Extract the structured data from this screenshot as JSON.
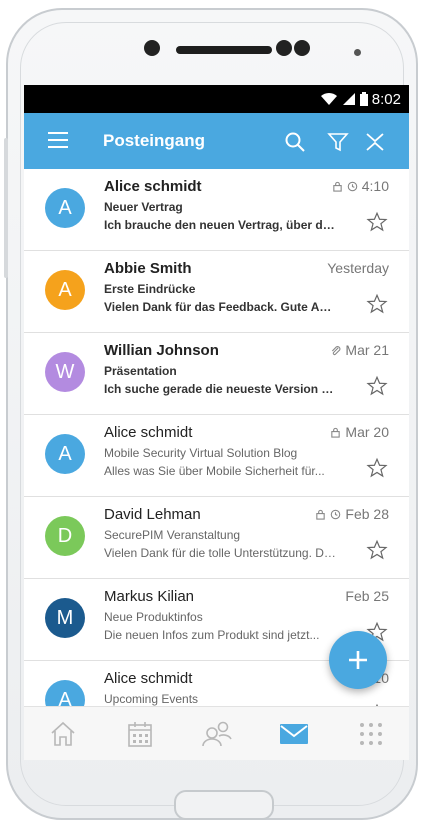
{
  "status_bar": {
    "time": "8:02"
  },
  "app_bar": {
    "title": "Posteingang",
    "icons": [
      "menu-icon",
      "search-icon",
      "filter-icon",
      "collapse-icon"
    ]
  },
  "messages": [
    {
      "sender": "Alice schmidt",
      "subject": "Neuer Vertrag",
      "preview": "Ich brauche den neuen Vertrag, über den...",
      "time": "4:10",
      "avatar_letter": "A",
      "avatar_color": "#4aa8e0",
      "unread": true,
      "meta_icons": [
        "lock-icon",
        "clock-icon"
      ]
    },
    {
      "sender": "Abbie Smith",
      "subject": "Erste Eindrücke",
      "preview": "Vielen Dank für das Feedback. Gute Arbeit...",
      "time": "Yesterday",
      "avatar_letter": "A",
      "avatar_color": "#f5a21c",
      "unread": true,
      "meta_icons": []
    },
    {
      "sender": "Willian Johnson",
      "subject": "Präsentation",
      "preview": "Ich suche gerade die neueste Version der...",
      "time": "Mar 21",
      "avatar_letter": "W",
      "avatar_color": "#b38be0",
      "unread": true,
      "meta_icons": [
        "attachment-icon"
      ]
    },
    {
      "sender": "Alice schmidt",
      "subject": "Mobile Security Virtual Solution Blog",
      "preview": "Alles was Sie über Mobile Sicherheit für...",
      "time": "Mar 20",
      "avatar_letter": "A",
      "avatar_color": "#4aa8e0",
      "unread": false,
      "meta_icons": [
        "lock-icon"
      ]
    },
    {
      "sender": "David Lehman",
      "subject": "SecurePIM Veranstaltung",
      "preview": "Vielen Dank für die tolle Unterstützung. Die...",
      "time": "Feb 28",
      "avatar_letter": "D",
      "avatar_color": "#7bc95a",
      "unread": false,
      "meta_icons": [
        "lock-icon",
        "clock-icon"
      ]
    },
    {
      "sender": "Markus Kilian",
      "subject": "Neue Produktinfos",
      "preview": "Die neuen Infos zum Produkt sind jetzt...",
      "time": "Feb 25",
      "avatar_letter": "M",
      "avatar_color": "#1b5a8e",
      "unread": false,
      "meta_icons": []
    },
    {
      "sender": "Alice schmidt",
      "subject": "Upcoming Events",
      "preview": "",
      "time": "Feb 10",
      "avatar_letter": "A",
      "avatar_color": "#4aa8e0",
      "unread": false,
      "meta_icons": []
    }
  ],
  "fab": {
    "icon": "plus-icon"
  },
  "bottom_nav": [
    {
      "icon": "home-icon",
      "active": false
    },
    {
      "icon": "calendar-icon",
      "active": false
    },
    {
      "icon": "contacts-icon",
      "active": false
    },
    {
      "icon": "mail-icon",
      "active": true
    },
    {
      "icon": "apps-grid-icon",
      "active": false
    }
  ],
  "colors": {
    "accent": "#4aa8e0",
    "inactive_icon": "#b8b8b8"
  }
}
